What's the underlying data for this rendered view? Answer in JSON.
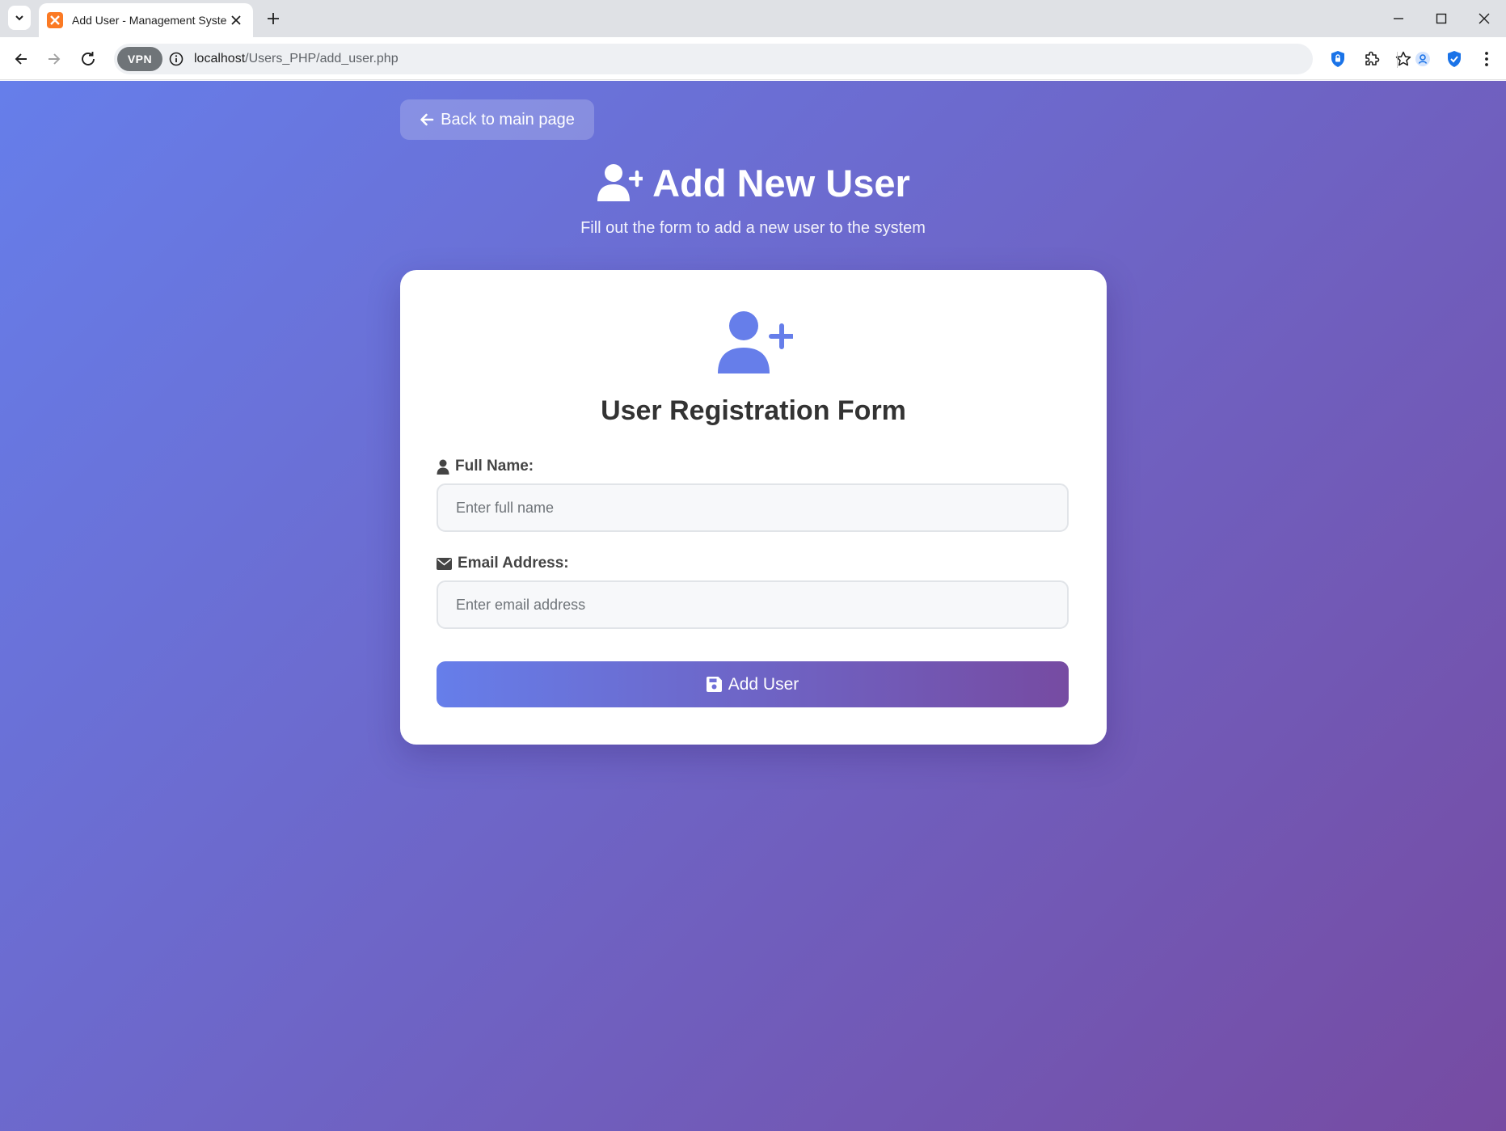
{
  "browser": {
    "tab_title": "Add User - Management System",
    "url_host": "localhost",
    "url_path": "/Users_PHP/add_user.php",
    "vpn_label": "VPN"
  },
  "page": {
    "back_label": "Back to main page",
    "title": "Add New User",
    "subtitle": "Fill out the form to add a new user to the system"
  },
  "form": {
    "heading": "User Registration Form",
    "fields": [
      {
        "label": "Full Name:",
        "placeholder": "Enter full name",
        "value": "",
        "icon": "user-icon"
      },
      {
        "label": "Email Address:",
        "placeholder": "Enter email address",
        "value": "",
        "icon": "envelope-icon"
      }
    ],
    "submit_label": "Add User",
    "submit_icon": "save-icon"
  },
  "colors": {
    "gradient_start": "#667eea",
    "gradient_end": "#764ba2",
    "accent": "#667eea",
    "heading_text": "#333333"
  }
}
